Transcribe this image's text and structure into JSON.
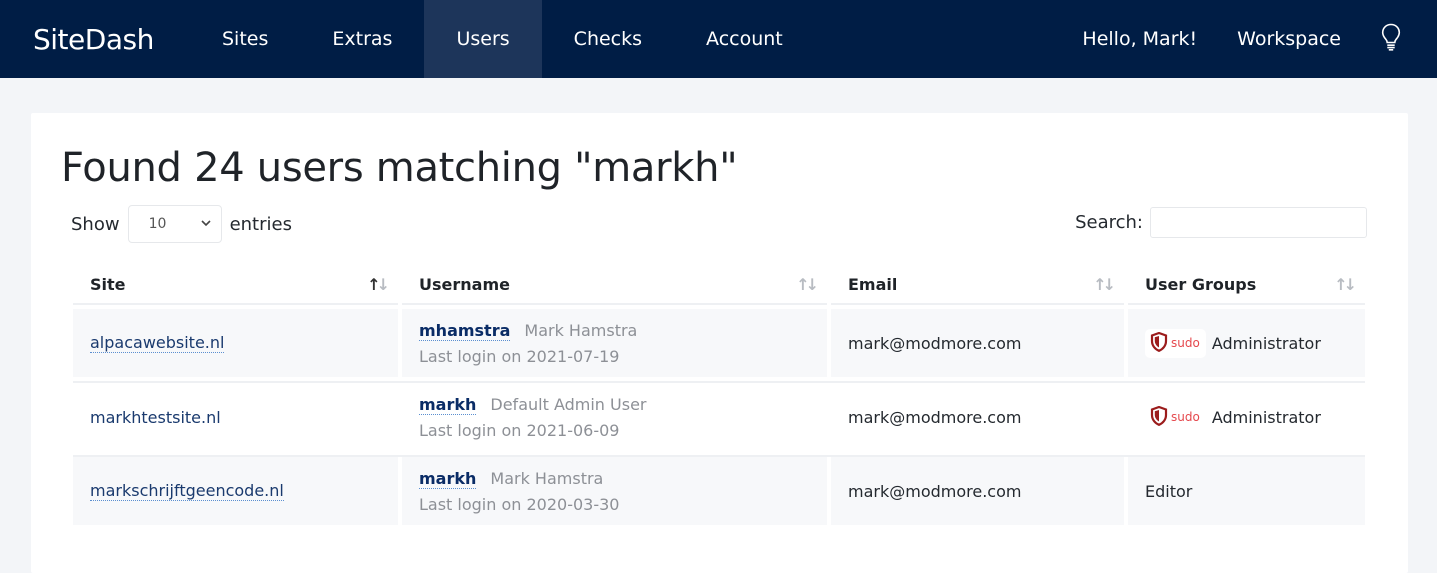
{
  "navbar": {
    "brand": "SiteDash",
    "items": [
      {
        "label": "Sites",
        "active": false
      },
      {
        "label": "Extras",
        "active": false
      },
      {
        "label": "Users",
        "active": true
      },
      {
        "label": "Checks",
        "active": false
      },
      {
        "label": "Account",
        "active": false
      }
    ],
    "greeting": "Hello, Mark!",
    "workspace": "Workspace",
    "tips_icon": "lightbulb-icon"
  },
  "page": {
    "title": "Found 24 users matching \"markh\"",
    "show_label": "Show",
    "entries_value": "10",
    "entries_label": "entries",
    "search_label": "Search:",
    "search_value": ""
  },
  "table": {
    "columns": [
      "Site",
      "Username",
      "Email",
      "User Groups"
    ],
    "rows": [
      {
        "site": "alpacawebsite.nl",
        "username": "mhamstra",
        "fullname": "Mark Hamstra",
        "last_login": "Last login on 2021-07-19",
        "email": "mark@modmore.com",
        "sudo": "sudo",
        "group": "Administrator"
      },
      {
        "site": "markhtestsite.nl",
        "username": "markh",
        "fullname": "Default Admin User",
        "last_login": "Last login on 2021-06-09",
        "email": "mark@modmore.com",
        "sudo": "sudo",
        "group": "Administrator"
      },
      {
        "site": "markschrijftgeencode.nl",
        "username": "markh",
        "fullname": "Mark Hamstra",
        "last_login": "Last login on 2020-03-30",
        "email": "mark@modmore.com",
        "sudo": null,
        "group": "Editor"
      }
    ]
  },
  "colors": {
    "navbar_bg": "#001d45",
    "nav_active_bg": "#1d355a",
    "link": "#1a3a6e",
    "sudo": "#e5484d",
    "shield": "#9b1c1c"
  }
}
